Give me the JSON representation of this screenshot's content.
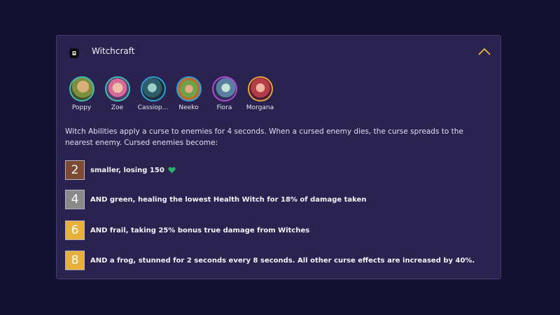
{
  "trait": {
    "title": "Witchcraft",
    "icon": "witch-icon",
    "collapse_icon": "chevron-up-icon",
    "accent_color": "#e8b93a"
  },
  "champions": [
    {
      "name": "Poppy"
    },
    {
      "name": "Zoe"
    },
    {
      "name": "Cassiop..."
    },
    {
      "name": "Neeko"
    },
    {
      "name": "Fiora"
    },
    {
      "name": "Morgana"
    }
  ],
  "description": "Witch Abilities apply a curse to enemies for 4 seconds. When a cursed enemy dies, the curse spreads to the nearest enemy. Cursed enemies become:",
  "tiers": [
    {
      "count": "2",
      "text": "smaller, losing 150",
      "icon": "heart-icon",
      "color": "#7a4a32"
    },
    {
      "count": "4",
      "text": "AND green, healing the lowest Health Witch for 18% of damage taken",
      "color": "#8a8a8a"
    },
    {
      "count": "6",
      "text": "AND frail, taking 25% bonus true damage from Witches",
      "color": "#e8b03a"
    },
    {
      "count": "8",
      "text": "AND a frog, stunned for 2 seconds every 8 seconds. All other curse effects are increased by 40%.",
      "color": "#e8b03a"
    }
  ]
}
